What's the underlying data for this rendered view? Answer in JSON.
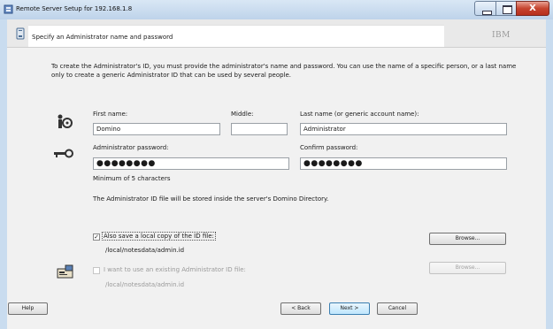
{
  "window": {
    "title": "Remote Server Setup for 192.168.1.8",
    "controls": {
      "minimize": "—",
      "maximize": "□",
      "close": "X"
    }
  },
  "header": {
    "heading": "Specify an Administrator name and password",
    "brand": "IBM"
  },
  "intro": "To create the Administrator's ID, you must provide the administrator's name and password. You can use the name of a specific person, or a last name only to create a generic Administrator ID that can be used by several people.",
  "form": {
    "first_name": {
      "label": "First name:",
      "value": "Domino"
    },
    "middle": {
      "label": "Middle:",
      "value": ""
    },
    "last_name": {
      "label": "Last name (or generic account name):",
      "value": "Administrator"
    },
    "admin_password": {
      "label": "Administrator password:",
      "value": "●●●●●●●●"
    },
    "confirm_password": {
      "label": "Confirm password:",
      "value": "●●●●●●●●"
    },
    "password_hint": "Minimum of 5 characters",
    "id_note": "The Administrator ID file will be stored inside the server's Domino Directory."
  },
  "local_copy": {
    "label": "Also save a local copy of the ID file:",
    "checked": true,
    "path": "/local/notesdata/admin.id",
    "browse": "Browse..."
  },
  "existing_id": {
    "label": "I want to use an existing Administrator ID file:",
    "checked": false,
    "path": "/local/notesdata/admin.id",
    "browse": "Browse..."
  },
  "footer": {
    "help": "Help",
    "back": "< Back",
    "next": "Next >",
    "cancel": "Cancel"
  },
  "icons": {
    "app": "server-setup-icon",
    "header": "document-icon",
    "person": "person-icon",
    "key": "key-icon",
    "id_card": "id-card-icon",
    "check": "✓"
  }
}
